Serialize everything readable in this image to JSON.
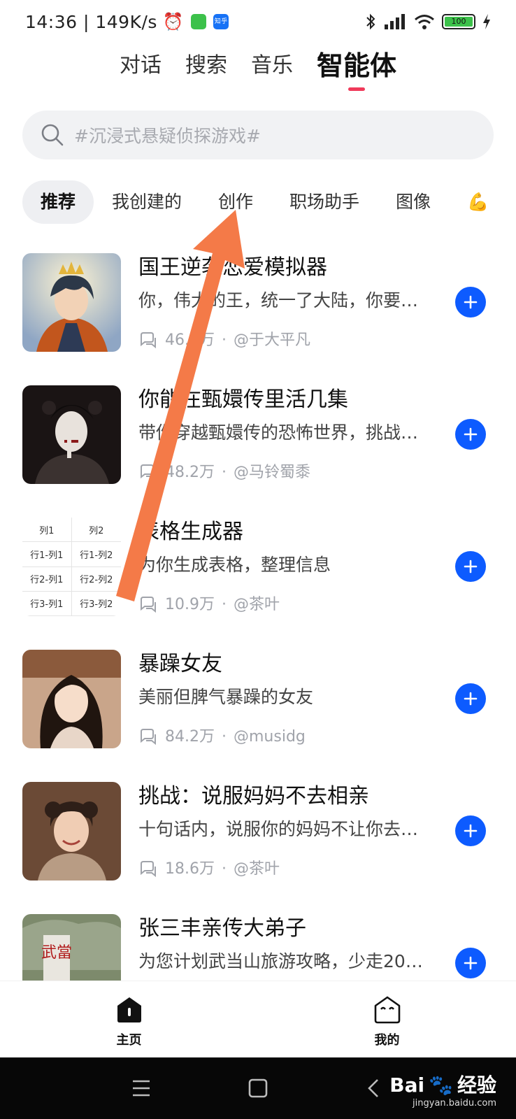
{
  "status_bar": {
    "time_speed": "14:36 | 149K/s",
    "badge_zhihu": "知乎",
    "battery": "100"
  },
  "top_tabs": [
    {
      "label": "对话",
      "active": false
    },
    {
      "label": "搜索",
      "active": false
    },
    {
      "label": "音乐",
      "active": false
    },
    {
      "label": "智能体",
      "active": true
    }
  ],
  "search": {
    "placeholder": "#沉浸式悬疑侦探游戏#"
  },
  "chips": [
    {
      "label": "推荐",
      "active": true
    },
    {
      "label": "我创建的",
      "active": false
    },
    {
      "label": "创作",
      "active": false
    },
    {
      "label": "职场助手",
      "active": false
    },
    {
      "label": "图像",
      "active": false
    },
    {
      "label": "💪",
      "active": false
    }
  ],
  "agents": [
    {
      "name": "国王逆袭恋爱模拟器",
      "desc": "你，伟大的王，统一了大陆，你要…",
      "count": "46.1万",
      "author": "@于大平凡"
    },
    {
      "name": "你能在甄嬛传里活几集",
      "desc": "带你穿越甄嬛传的恐怖世界，挑战…",
      "count": "48.2万",
      "author": "@马铃蜀黍"
    },
    {
      "name": "表格生成器",
      "desc": "为你生成表格，整理信息",
      "count": "10.9万",
      "author": "@茶叶"
    },
    {
      "name": "暴躁女友",
      "desc": "美丽但脾气暴躁的女友",
      "count": "84.2万",
      "author": "@musidg"
    },
    {
      "name": "挑战：说服妈妈不去相亲",
      "desc": "十句话内，说服你的妈妈不让你去…",
      "count": "18.6万",
      "author": "@茶叶"
    },
    {
      "name": "张三丰亲传大弟子",
      "desc": "为您计划武当山旅游攻略，少走20…",
      "count": "",
      "author": ""
    }
  ],
  "table_thumb": {
    "cells": [
      "列1",
      "列2",
      "行1-列1",
      "行1-列2",
      "行2-列1",
      "行2-列2",
      "行3-列1",
      "行3-列2"
    ]
  },
  "wudang_sign": "武當",
  "bottom_nav": [
    {
      "label": "主页",
      "icon": "home-icon"
    },
    {
      "label": "我的",
      "icon": "profile-face-icon"
    }
  ],
  "watermark": {
    "brand": "Bai",
    "suffix": "经验",
    "url": "jingyan.baidu.com"
  },
  "colors": {
    "accent_blue": "#0d5bff",
    "tab_underline": "#f03a5a",
    "annotation_arrow": "#f47a48"
  }
}
